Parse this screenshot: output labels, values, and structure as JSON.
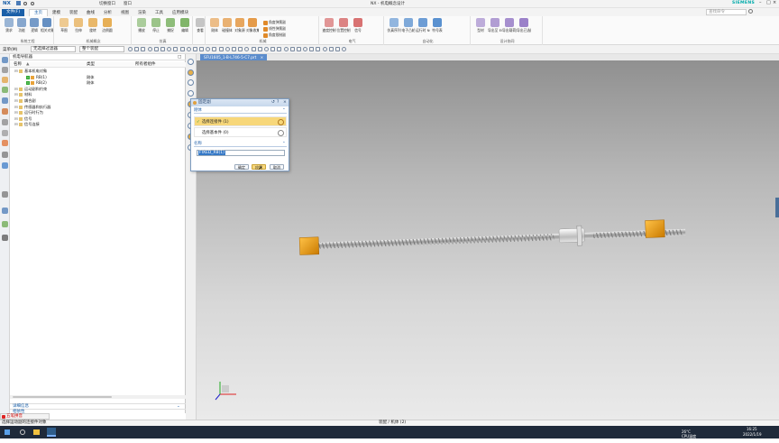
{
  "window": {
    "logo": "NX",
    "title": "NX - 机电概念设计",
    "quick_access": "切换窗口",
    "brand": "SIEMENS",
    "window_label": "窗口"
  },
  "menubar": {
    "file_tab": "文件(F)",
    "tabs": [
      "主页",
      "建模",
      "装配",
      "曲线",
      "分析",
      "视图",
      "渲染",
      "工具",
      "应用模块"
    ],
    "active_index": 0,
    "search_placeholder": "查找命令"
  },
  "ribbon": {
    "groups": [
      {
        "label": "系统工程",
        "buttons": [
          "需求",
          "功能",
          "逻辑",
          "相关对象"
        ]
      },
      {
        "label": "机械概念",
        "buttons": [
          "草图",
          "拉伸",
          "旋转",
          "边倒圆"
        ]
      },
      {
        "label": "仿真",
        "buttons": [
          "播放",
          "停止",
          "捕捉",
          "编辑"
        ]
      },
      {
        "label": "",
        "buttons": [
          "查看"
        ]
      },
      {
        "label": "机械",
        "buttons": [
          "刚体",
          "碰撞体",
          "对象源",
          "对象收集器",
          "角度弹簧副",
          "线性弹簧副",
          "角度限制副"
        ]
      },
      {
        "label": "电气",
        "buttons": [
          "速度控制",
          "位置控制",
          "信号"
        ]
      },
      {
        "label": "自动化",
        "buttons": [
          "仿真序列",
          "电子凸轮",
          "运行时 NC",
          "符号表"
        ]
      },
      {
        "label": "设计协同",
        "buttons": [
          "型材",
          "导出至 ECAD",
          "导出载荷曲线",
          "导出已选插件"
        ]
      }
    ]
  },
  "toolbar2": {
    "menu_label": "菜单(M)",
    "selection_filter": "无选择过滤器",
    "scope": "整个装配"
  },
  "file_tab": {
    "name": "SFU1605_1-B-L746-5-C7.prt"
  },
  "navigator": {
    "title": "机电导航器",
    "columns": [
      "名称",
      "类型",
      "所有者组件"
    ],
    "rows": [
      {
        "level": 0,
        "label": "基本机电对象",
        "type": "",
        "checked": false,
        "folder": true
      },
      {
        "level": 1,
        "label": "RB(1)",
        "type": "刚体",
        "checked": true,
        "folder": false
      },
      {
        "level": 1,
        "label": "RB(2)",
        "type": "刚体",
        "checked": true,
        "folder": false
      },
      {
        "level": 0,
        "label": "运动副和约束",
        "type": "",
        "checked": false,
        "folder": true
      },
      {
        "level": 0,
        "label": "材料",
        "type": "",
        "checked": false,
        "folder": true
      },
      {
        "level": 0,
        "label": "耦合副",
        "type": "",
        "checked": false,
        "folder": true
      },
      {
        "level": 0,
        "label": "传感器和执行器",
        "type": "",
        "checked": false,
        "folder": true
      },
      {
        "level": 0,
        "label": "运行时行为",
        "type": "",
        "checked": false,
        "folder": true
      },
      {
        "level": 0,
        "label": "信号",
        "type": "",
        "checked": false,
        "folder": true
      },
      {
        "level": 0,
        "label": "信号连接",
        "type": "",
        "checked": false,
        "folder": true
      }
    ],
    "footer": "详细信息",
    "footer2": "相依性"
  },
  "dialog": {
    "title": "固定副",
    "section_rigid": "刚体",
    "select_connection": "选择连接件 (1)",
    "select_base": "选择基本件 (0)",
    "section_name": "名称",
    "name_value": "FIXED_R8(1)",
    "ok": "确定",
    "apply": "应用",
    "cancel": "取消"
  },
  "statusbar": {
    "prompt": "选择运动副的连接件对象",
    "center": "装配 / 机体 (2)"
  },
  "taskbar": {
    "app_tag": "五笔拼音",
    "weather": "26°C",
    "cpu": "CPU温度",
    "time": "16:25",
    "date": "2022/1/19"
  },
  "colors": {
    "accent": "#1a5fa8",
    "dialog_highlight": "#f7d77a",
    "end_block": "#f0a21a",
    "viewport_top": "#909090",
    "viewport_bottom": "#eaeaea"
  }
}
